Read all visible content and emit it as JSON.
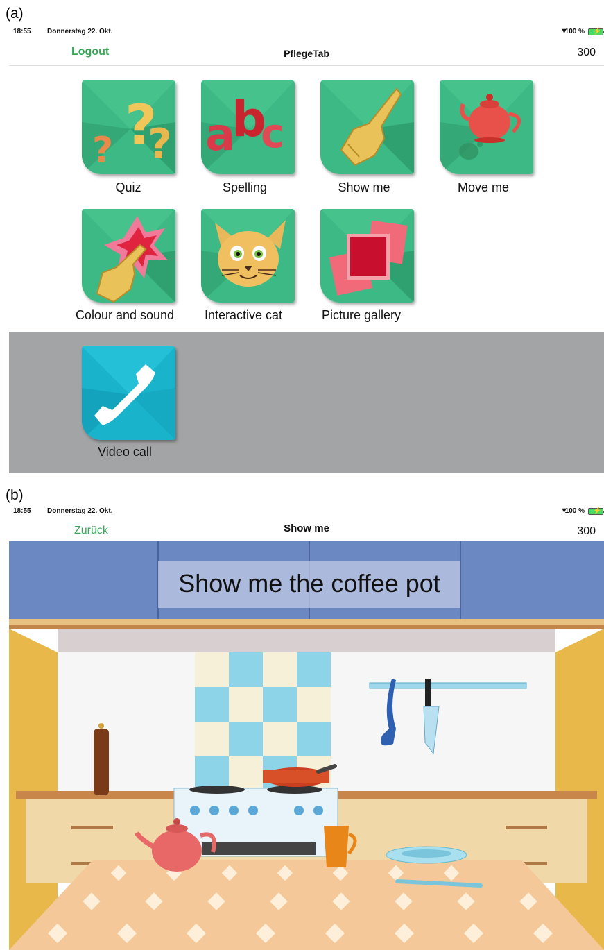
{
  "panel_a": {
    "label": "(a)",
    "status": {
      "time": "18:55",
      "date": "Donnerstag 22. Okt.",
      "battery": "100 %"
    },
    "nav": {
      "left": "Logout",
      "title": "PflegeTab",
      "right": "300"
    },
    "tiles": [
      {
        "label": "Quiz",
        "icon": "question-marks-icon"
      },
      {
        "label": "Spelling",
        "icon": "abc-letters-icon"
      },
      {
        "label": "Show me",
        "icon": "pointing-hand-icon"
      },
      {
        "label": "Move me",
        "icon": "teapot-icon"
      },
      {
        "label": "Colour and sound",
        "icon": "splash-touch-icon"
      },
      {
        "label": "Interactive cat",
        "icon": "cat-face-icon"
      },
      {
        "label": "Picture gallery",
        "icon": "pictures-icon"
      }
    ],
    "video_call": {
      "label": "Video call",
      "icon": "phone-icon"
    },
    "colors": {
      "tile_green": "#3cb984",
      "accent_green": "#34a853",
      "call_blue": "#19b3cc",
      "gray_band": "#a3a4a6"
    }
  },
  "panel_b": {
    "label": "(b)",
    "status": {
      "time": "18:55",
      "date": "Donnerstag 22. Okt.",
      "battery": "100 %"
    },
    "nav": {
      "left": "Zurück",
      "title": "Show me",
      "right": "300"
    },
    "prompt": "Show me the coffee pot",
    "scene_objects": [
      "pepper-mill",
      "teapot",
      "frying-pan",
      "stove",
      "mug",
      "plate",
      "fork",
      "ladle",
      "knife",
      "tiles",
      "tablecloth"
    ]
  }
}
